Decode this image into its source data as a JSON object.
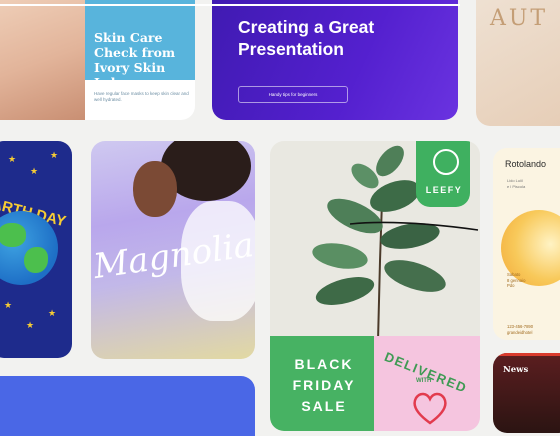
{
  "skin_card": {
    "title": "Skin Care Check from Ivory Skin Lab",
    "subtitle": "Have regular face masks to keep skin clear and well hydrated."
  },
  "presentation_card": {
    "title": "Creating a Great Presentation",
    "button": "Handy tips for beginners"
  },
  "autumn_card": {
    "title": "AUT"
  },
  "earth_card": {
    "title": "EARTH DAY"
  },
  "magnolia_card": {
    "title": "Magnolia"
  },
  "leefy_card": {
    "brand": "LEEFY",
    "sale_line1": "BLACK",
    "sale_line2": "FRIDAY",
    "sale_line3": "SALE",
    "delivered": "DELIVERED",
    "with": "WITH"
  },
  "rotolando_card": {
    "title": "Rotolando",
    "info_line1": "Lido Luiil",
    "info_line2": "e l Piscola",
    "sched_line1": "Sabato",
    "sched_line2": "8 gennaio",
    "sched_line3": "Pdo",
    "contact_line1": "123-456-7890",
    "contact_line2": "grandeidhotel"
  },
  "news_card": {
    "title": "News"
  },
  "colors": {
    "skin_panel": "#58b4dc",
    "presentation_bg": "#5420cf",
    "earth_bg": "#1e2b8c",
    "leefy_green": "#47b263",
    "delivered_pink": "#f5c5df",
    "blue_card": "#4a67e6"
  }
}
